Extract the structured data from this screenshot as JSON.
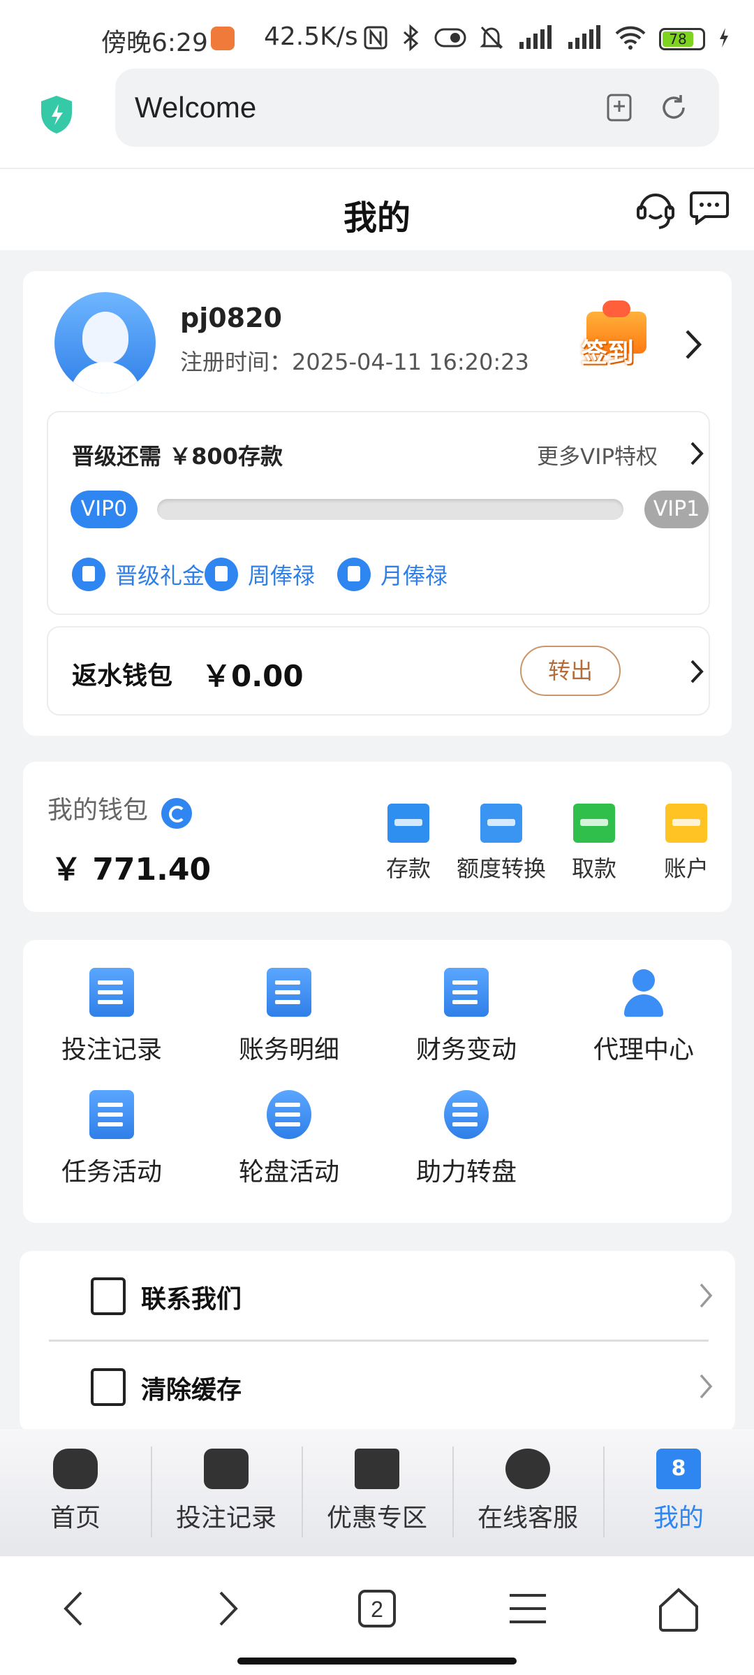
{
  "status_bar": {
    "time": "傍晚6:29",
    "net_speed": "42.5K/s",
    "battery": "78",
    "battery_level": 0.78
  },
  "browser": {
    "url_text": "Welcome",
    "icons": [
      "shield-icon",
      "add-bookmark-icon",
      "reload-icon"
    ]
  },
  "header": {
    "title": "我的",
    "icons": [
      "customer-service-icon",
      "message-icon"
    ]
  },
  "profile": {
    "username": "pj0820",
    "reg_time": "注册时间：2025-04-11 16:20:23",
    "signin_label": "签到"
  },
  "vip": {
    "need_text": "晋级还需 ￥800存款",
    "more_text": "更多VIP特权",
    "from_level": "VIP0",
    "to_level": "VIP1",
    "progress": 0,
    "perks": [
      "晋级礼金",
      "周俸禄",
      "月俸禄"
    ]
  },
  "rebate": {
    "label": "返水钱包",
    "amount": "￥0.00",
    "button": "转出"
  },
  "wallet": {
    "label": "我的钱包",
    "amount": "￥ 771.40",
    "ops": [
      "存款",
      "额度转换",
      "取款",
      "账户"
    ]
  },
  "menu": {
    "items": [
      "投注记录",
      "账务明细",
      "财务变动",
      "代理中心",
      "任务活动",
      "轮盘活动",
      "助力转盘"
    ]
  },
  "list": {
    "items": [
      "联系我们",
      "清除缓存"
    ]
  },
  "tabs": {
    "items": [
      "首页",
      "投注记录",
      "优惠专区",
      "在线客服",
      "我的"
    ],
    "active_index": 4,
    "shirt_number": "8"
  },
  "nav": {
    "tab_count": "2"
  },
  "colors": {
    "accent": "#2f86f0",
    "rebate_button": "#b46e3c",
    "page_bg": "#f2f3f5"
  }
}
